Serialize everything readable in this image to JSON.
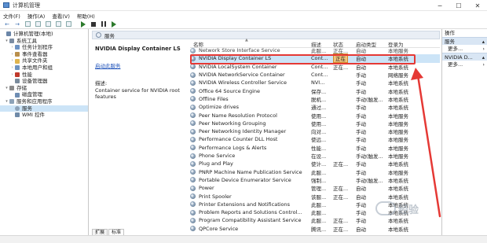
{
  "window": {
    "title": "计算机管理",
    "minimize": "─",
    "maximize": "☐",
    "close": "✕"
  },
  "menu": [
    "文件(F)",
    "操作(A)",
    "查看(V)",
    "帮助(H)"
  ],
  "toolbar": {
    "back": "←",
    "forward": "→"
  },
  "tree": {
    "items": [
      {
        "label": "计算机管理(本地)",
        "color": "#6b86a8",
        "level": 0,
        "arrow": ""
      },
      {
        "label": "系统工具",
        "color": "#7c8da3",
        "level": 1,
        "arrow": "▾"
      },
      {
        "label": "任务计划程序",
        "color": "#6e93c3",
        "level": 2,
        "arrow": "›"
      },
      {
        "label": "事件查看器",
        "color": "#b98f4c",
        "level": 2,
        "arrow": "›"
      },
      {
        "label": "共享文件夹",
        "color": "#e0b54e",
        "level": 2,
        "arrow": "›"
      },
      {
        "label": "本地用户和组",
        "color": "#6f93bf",
        "level": 2,
        "arrow": "›"
      },
      {
        "label": "性能",
        "color": "#c0392b",
        "level": 2,
        "arrow": "›"
      },
      {
        "label": "设备管理器",
        "color": "#7a8b9c",
        "level": 2,
        "arrow": ""
      },
      {
        "label": "存储",
        "color": "#8a8a8a",
        "level": 1,
        "arrow": "▾"
      },
      {
        "label": "磁盘管理",
        "color": "#6e8db3",
        "level": 2,
        "arrow": ""
      },
      {
        "label": "服务和应用程序",
        "color": "#8da2b8",
        "level": 1,
        "arrow": "▾"
      },
      {
        "label": "服务",
        "color": "#8da2b8",
        "level": 2,
        "arrow": "",
        "selected": true
      },
      {
        "label": "WMI 控件",
        "color": "#6f8aa8",
        "level": 2,
        "arrow": ""
      }
    ]
  },
  "header": {
    "title": "服务"
  },
  "detail": {
    "service_title": "NVIDIA Display Container LS",
    "link": "启动此服务",
    "desc_label": "描述:",
    "desc_body": "Container service for NVIDIA root features"
  },
  "columns": {
    "name": "名称",
    "desc": "描述",
    "status": "状态",
    "start": "启动类型",
    "logon": "登录为"
  },
  "services": [
    {
      "name": "Network Store Interface Service",
      "desc": "此服...",
      "status": "正在...",
      "start": "自动",
      "logon": "本地服务"
    },
    {
      "name": "NVIDIA Display Container LS",
      "desc": "Cont...",
      "status": "正在",
      "start": "自动",
      "logon": "本地系统",
      "selected": true
    },
    {
      "name": "NVIDIA LocalSystem Container",
      "desc": "Cont...",
      "status": "正在...",
      "start": "自动",
      "logon": "本地系统"
    },
    {
      "name": "NVIDIA NetworkService Container",
      "desc": "Cont...",
      "status": "",
      "start": "手动",
      "logon": "网络服务"
    },
    {
      "name": "NVIDIA Wireless Controller Service",
      "desc": "NVI...",
      "status": "",
      "start": "手动",
      "logon": "本地系统"
    },
    {
      "name": "Office 64 Source Engine",
      "desc": "保存...",
      "status": "",
      "start": "手动",
      "logon": "本地系统"
    },
    {
      "name": "Offline Files",
      "desc": "脱机...",
      "status": "",
      "start": "手动(触发...",
      "logon": "本地系统"
    },
    {
      "name": "Optimize drives",
      "desc": "通过...",
      "status": "",
      "start": "手动",
      "logon": "本地系统"
    },
    {
      "name": "Peer Name Resolution Protocol",
      "desc": "使用...",
      "status": "",
      "start": "手动",
      "logon": "本地服务"
    },
    {
      "name": "Peer Networking Grouping",
      "desc": "使用...",
      "status": "",
      "start": "手动",
      "logon": "本地服务"
    },
    {
      "name": "Peer Networking Identity Manager",
      "desc": "向对...",
      "status": "",
      "start": "手动",
      "logon": "本地服务"
    },
    {
      "name": "Performance Counter DLL Host",
      "desc": "使远...",
      "status": "",
      "start": "手动",
      "logon": "本地服务"
    },
    {
      "name": "Performance Logs & Alerts",
      "desc": "性能...",
      "status": "",
      "start": "手动",
      "logon": "本地服务"
    },
    {
      "name": "Phone Service",
      "desc": "在设...",
      "status": "",
      "start": "手动(触发...",
      "logon": "本地服务"
    },
    {
      "name": "Plug and Play",
      "desc": "使计...",
      "status": "正在...",
      "start": "手动",
      "logon": "本地系统"
    },
    {
      "name": "PNRP Machine Name Publication Service",
      "desc": "此服...",
      "status": "",
      "start": "手动",
      "logon": "本地服务"
    },
    {
      "name": "Portable Device Enumerator Service",
      "desc": "强制...",
      "status": "",
      "start": "手动(触发...",
      "logon": "本地系统"
    },
    {
      "name": "Power",
      "desc": "管理...",
      "status": "正在...",
      "start": "自动",
      "logon": "本地系统"
    },
    {
      "name": "Print Spooler",
      "desc": "该服...",
      "status": "正在...",
      "start": "自动",
      "logon": "本地系统"
    },
    {
      "name": "Printer Extensions and Notifications",
      "desc": "此服...",
      "status": "",
      "start": "手动",
      "logon": "本地系统"
    },
    {
      "name": "Problem Reports and Solutions Control...",
      "desc": "此服...",
      "status": "",
      "start": "手动",
      "logon": "本地系统"
    },
    {
      "name": "Program Compatibility Assistant Service",
      "desc": "此服...",
      "status": "正在...",
      "start": "手动",
      "logon": "本地系统"
    },
    {
      "name": "QPCore Service",
      "desc": "腾讯...",
      "status": "正在...",
      "start": "自动",
      "logon": "本地系统"
    }
  ],
  "tabs": [
    "扩展",
    "标准"
  ],
  "actions": {
    "head": "操作",
    "section1": "服务",
    "more1": "更多...",
    "section2": "NVIDIA D...",
    "more2": "更多..."
  },
  "watermark": {
    "text": "经验"
  }
}
